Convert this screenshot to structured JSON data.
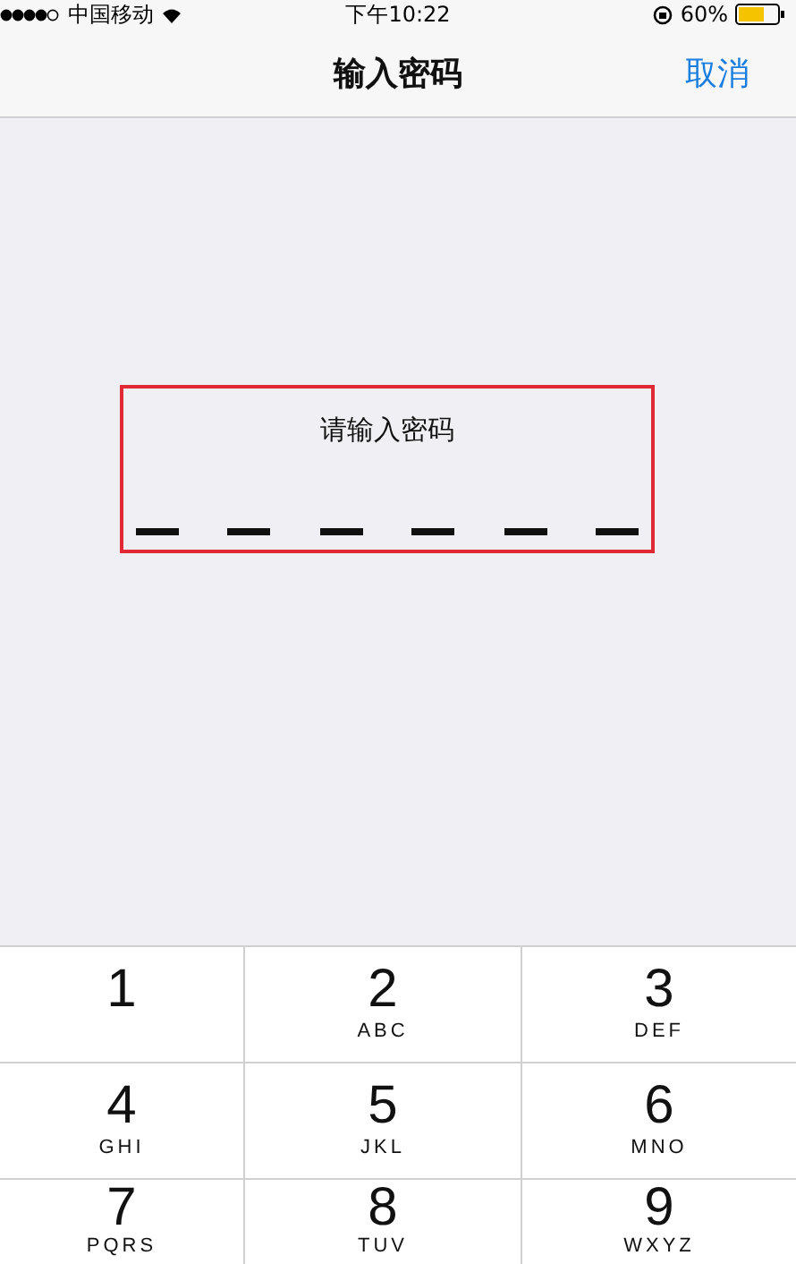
{
  "status_bar": {
    "carrier": "中国移动",
    "time": "下午10:22",
    "battery": "60%"
  },
  "nav_bar": {
    "title": "输入密码",
    "cancel": "取消"
  },
  "passcode": {
    "prompt": "请输入密码",
    "slots": [
      {
        "filled": false
      },
      {
        "filled": false
      },
      {
        "filled": false
      },
      {
        "filled": false
      },
      {
        "filled": false
      },
      {
        "filled": false
      }
    ]
  },
  "keypad": [
    {
      "digit": "1"
    },
    {
      "digit": "2",
      "letters": "ABC"
    },
    {
      "digit": "3",
      "letters": "DEF"
    },
    {
      "digit": "4",
      "letters": "GHI"
    },
    {
      "digit": "5",
      "letters": "JKL"
    },
    {
      "digit": "6",
      "letters": "MNO"
    },
    {
      "digit": "7",
      "letters": "PQRS"
    },
    {
      "digit": "8",
      "letters": "TUV"
    },
    {
      "digit": "9",
      "letters": "WXYZ"
    }
  ]
}
